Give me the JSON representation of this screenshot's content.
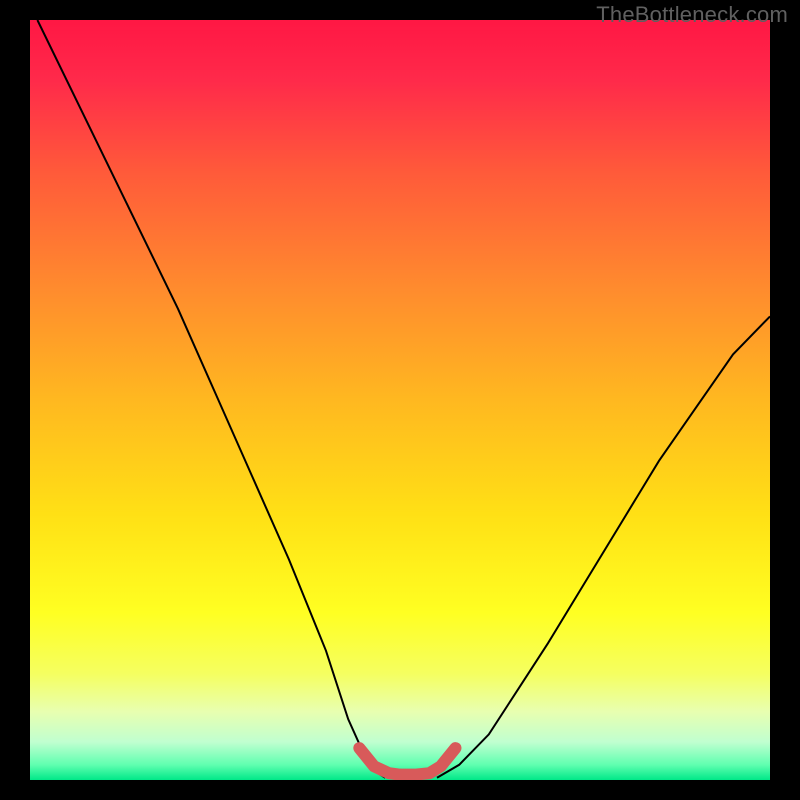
{
  "watermark": "TheBottleneck.com",
  "chart_data": {
    "type": "line",
    "title": "",
    "xlabel": "",
    "ylabel": "",
    "xlim": [
      0,
      100
    ],
    "ylim": [
      0,
      100
    ],
    "grid": false,
    "background": {
      "type": "vertical-gradient",
      "stops": [
        {
          "offset": 0.0,
          "color": "#ff1744"
        },
        {
          "offset": 0.08,
          "color": "#ff2a4a"
        },
        {
          "offset": 0.2,
          "color": "#ff5a3a"
        },
        {
          "offset": 0.35,
          "color": "#ff8a2e"
        },
        {
          "offset": 0.5,
          "color": "#ffb820"
        },
        {
          "offset": 0.65,
          "color": "#ffe015"
        },
        {
          "offset": 0.78,
          "color": "#ffff22"
        },
        {
          "offset": 0.86,
          "color": "#f5ff60"
        },
        {
          "offset": 0.91,
          "color": "#e8ffb0"
        },
        {
          "offset": 0.95,
          "color": "#c0ffd0"
        },
        {
          "offset": 0.98,
          "color": "#60ffb0"
        },
        {
          "offset": 1.0,
          "color": "#00e888"
        }
      ]
    },
    "series": [
      {
        "name": "curve-left",
        "color": "#000000",
        "stroke_width": 2,
        "x": [
          1,
          5,
          10,
          15,
          20,
          25,
          30,
          35,
          40,
          43,
          46,
          48
        ],
        "values": [
          100,
          92,
          82,
          72,
          62,
          51,
          40,
          29,
          17,
          8,
          1.5,
          0.3
        ]
      },
      {
        "name": "curve-right",
        "color": "#000000",
        "stroke_width": 2,
        "x": [
          55,
          58,
          62,
          66,
          70,
          75,
          80,
          85,
          90,
          95,
          100
        ],
        "values": [
          0.3,
          2,
          6,
          12,
          18,
          26,
          34,
          42,
          49,
          56,
          61
        ]
      },
      {
        "name": "optimal-zone",
        "color": "#d85a5a",
        "stroke_width": 12,
        "linecap": "round",
        "x": [
          44.5,
          46.5,
          48.5,
          50,
          52,
          54,
          55.5,
          57.5
        ],
        "values": [
          4.2,
          1.8,
          0.9,
          0.7,
          0.7,
          0.9,
          1.8,
          4.2
        ]
      }
    ]
  }
}
